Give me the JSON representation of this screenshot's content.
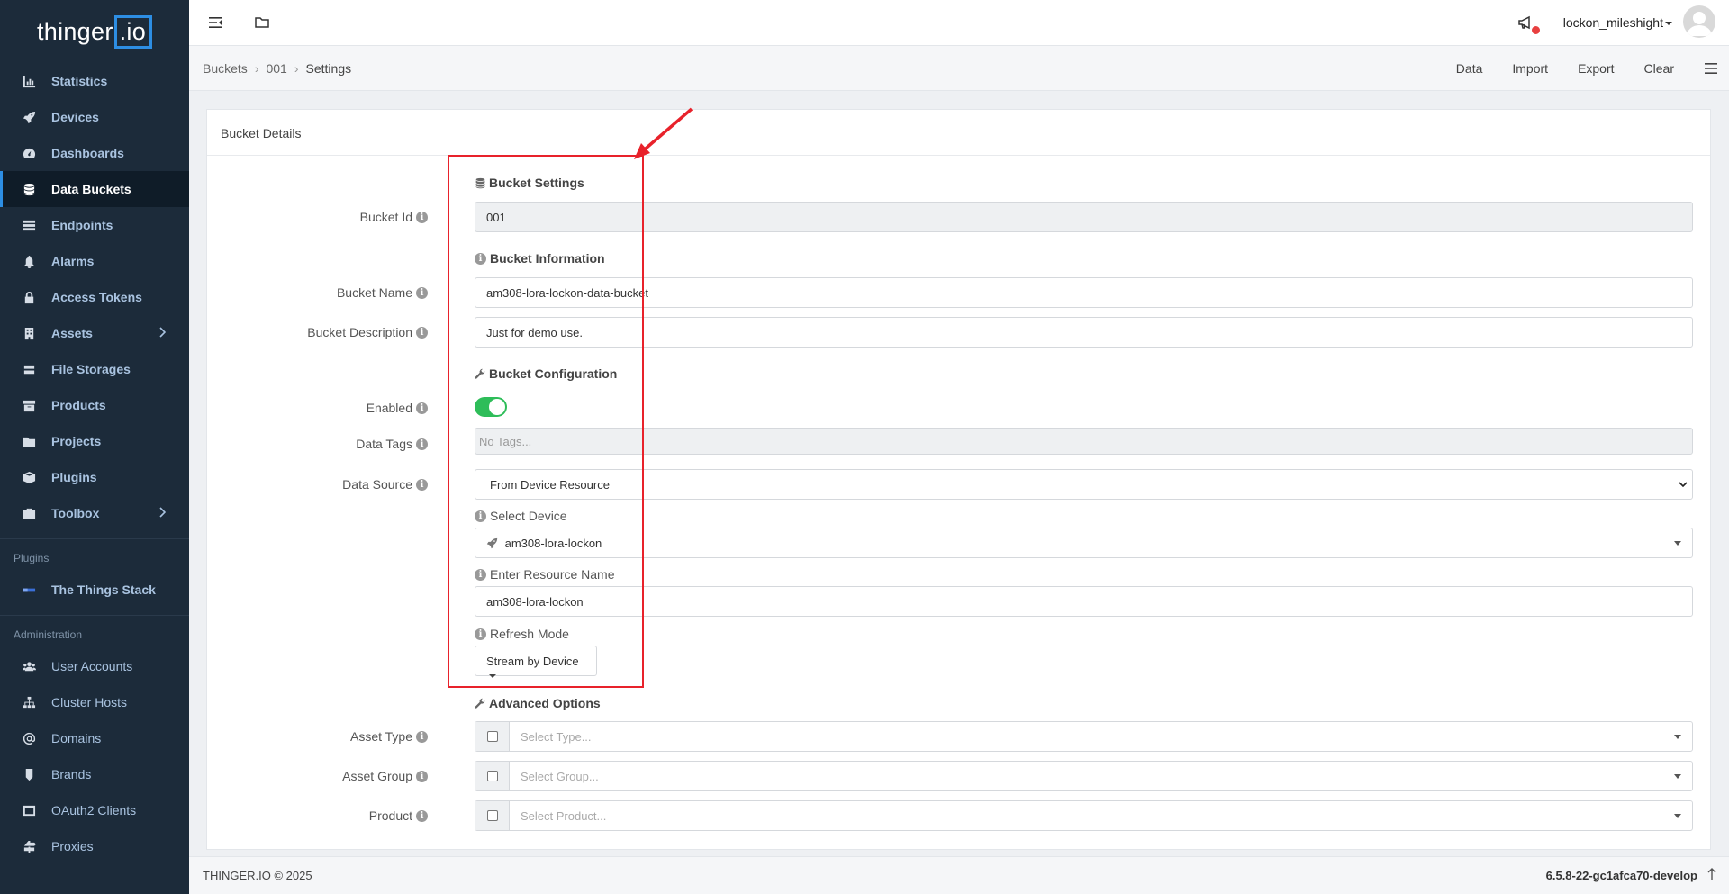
{
  "brand": {
    "logo_main": "thinger",
    "logo_boxed": ".io"
  },
  "sidebar": {
    "items": [
      {
        "label": "Statistics",
        "icon": "chart-icon"
      },
      {
        "label": "Devices",
        "icon": "rocket-icon"
      },
      {
        "label": "Dashboards",
        "icon": "dashboard-icon"
      },
      {
        "label": "Data Buckets",
        "icon": "database-icon",
        "active": true
      },
      {
        "label": "Endpoints",
        "icon": "server-icon"
      },
      {
        "label": "Alarms",
        "icon": "bell-icon"
      },
      {
        "label": "Access Tokens",
        "icon": "lock-icon"
      },
      {
        "label": "Assets",
        "icon": "building-icon"
      },
      {
        "label": "File Storages",
        "icon": "hdd-icon"
      },
      {
        "label": "Products",
        "icon": "box-icon"
      },
      {
        "label": "Projects",
        "icon": "folder-icon"
      },
      {
        "label": "Plugins",
        "icon": "cube-icon"
      },
      {
        "label": "Toolbox",
        "icon": "toolbox-icon"
      }
    ],
    "plugins_heading": "Plugins",
    "plugins": [
      {
        "label": "The Things Stack",
        "icon": "tts-logo-icon"
      }
    ],
    "admin_heading": "Administration",
    "admin": [
      {
        "label": "User Accounts",
        "icon": "users-icon"
      },
      {
        "label": "Cluster Hosts",
        "icon": "sitemap-icon"
      },
      {
        "label": "Domains",
        "icon": "at-icon"
      },
      {
        "label": "Brands",
        "icon": "stamp-icon"
      },
      {
        "label": "OAuth2 Clients",
        "icon": "window-icon"
      },
      {
        "label": "Proxies",
        "icon": "signpost-icon"
      }
    ]
  },
  "topbar": {
    "username": "lockon_mileshight"
  },
  "breadcrumb": {
    "items": [
      "Buckets",
      "001",
      "Settings"
    ]
  },
  "actions": [
    "Data",
    "Import",
    "Export",
    "Clear"
  ],
  "panel": {
    "title": "Bucket Details",
    "sections": {
      "settings": "Bucket Settings",
      "information": "Bucket Information",
      "configuration": "Bucket Configuration",
      "advanced": "Advanced Options"
    },
    "labels": {
      "bucket_id": "Bucket Id",
      "bucket_name": "Bucket Name",
      "bucket_description": "Bucket Description",
      "enabled": "Enabled",
      "data_tags": "Data Tags",
      "data_source": "Data Source",
      "select_device": "Select Device",
      "resource_name": "Enter Resource Name",
      "refresh_mode": "Refresh Mode",
      "asset_type": "Asset Type",
      "asset_group": "Asset Group",
      "product": "Product"
    },
    "values": {
      "bucket_id": "001",
      "bucket_name": "am308-lora-lockon-data-bucket",
      "bucket_description": "Just for demo use.",
      "enabled": true,
      "data_tags_placeholder": "No Tags...",
      "data_source": "From Device Resource",
      "device": "am308-lora-lockon",
      "resource_name": "am308-lora-lockon",
      "refresh_mode": "Stream by Device",
      "asset_type_placeholder": "Select Type...",
      "asset_group_placeholder": "Select Group...",
      "product_placeholder": "Select Product..."
    }
  },
  "footer": {
    "copyright": "THINGER.IO © 2025",
    "version": "6.5.8-22-gc1afca70-develop"
  },
  "colors": {
    "sidebar_bg": "#1c2b3a",
    "accent": "#2d8ee3",
    "toggle_on": "#2ebd59",
    "annotation": "#e8222b"
  }
}
